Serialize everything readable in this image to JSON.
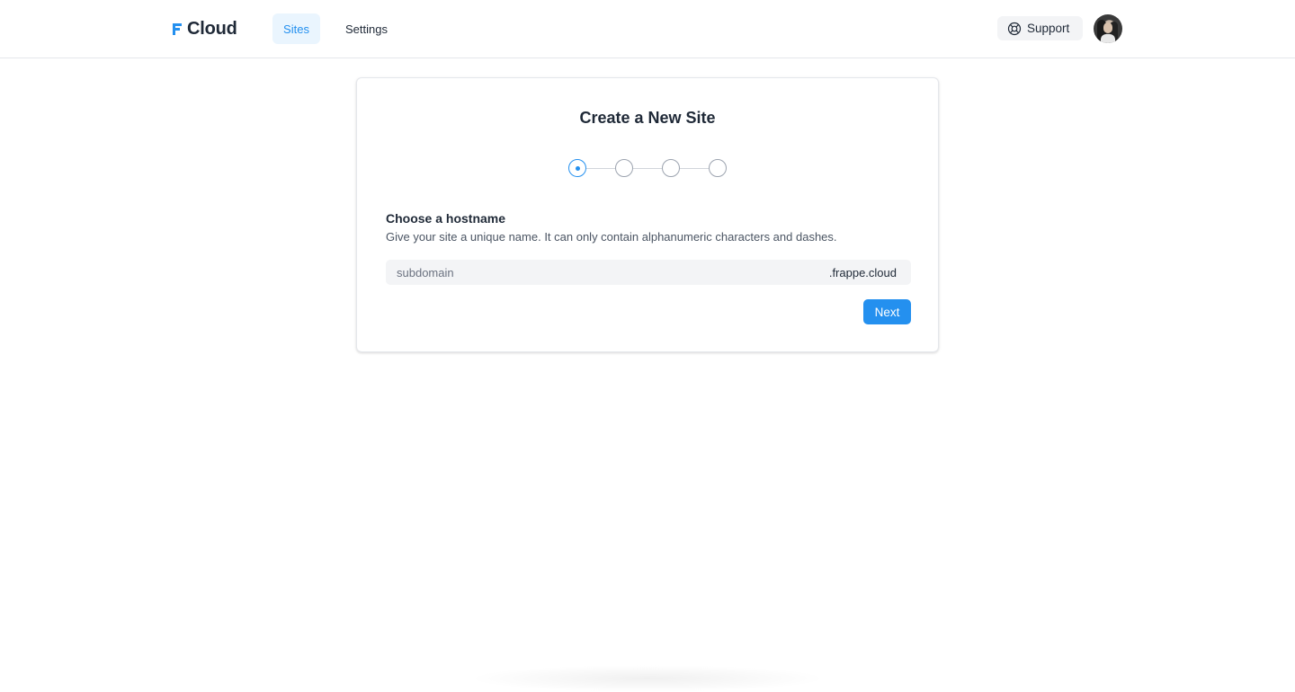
{
  "header": {
    "logo_text": "Cloud",
    "tabs": [
      {
        "label": "Sites",
        "active": true
      },
      {
        "label": "Settings",
        "active": false
      }
    ],
    "support_label": "Support"
  },
  "card": {
    "title": "Create a New Site",
    "steps": {
      "total": 4,
      "current": 1
    },
    "section_title": "Choose a hostname",
    "section_desc": "Give your site a unique name. It can only contain alphanumeric characters and dashes.",
    "subdomain_placeholder": "subdomain",
    "subdomain_value": "",
    "domain_suffix": ".frappe.cloud",
    "next_label": "Next"
  },
  "colors": {
    "accent": "#2490ef",
    "accent_light": "#eaf5fe",
    "input_bg": "#f3f4f6"
  }
}
